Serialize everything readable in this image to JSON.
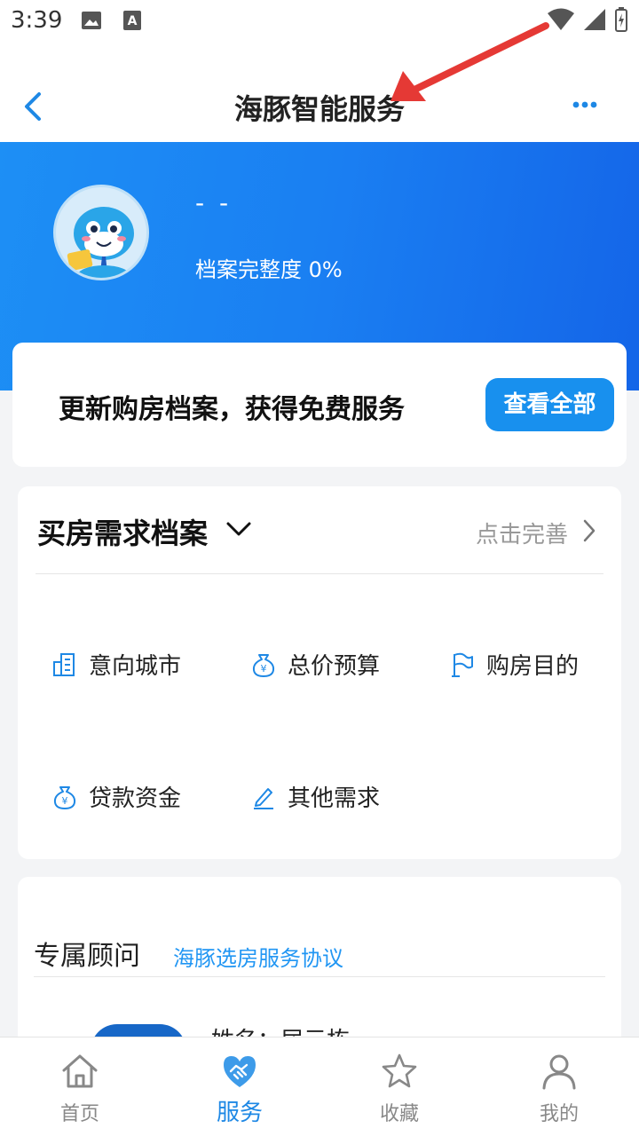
{
  "status_bar": {
    "time": "3:39"
  },
  "nav": {
    "title": "海豚智能服务"
  },
  "profile": {
    "name": "- -",
    "completeness": "档案完整度 0%"
  },
  "promo": {
    "text": "更新购房档案，获得免费服务",
    "button": "查看全部"
  },
  "demand": {
    "title": "买房需求档案",
    "action": "点击完善",
    "items": [
      {
        "label": "意向城市",
        "icon": "building-icon"
      },
      {
        "label": "总价预算",
        "icon": "money-bag-icon"
      },
      {
        "label": "购房目的",
        "icon": "flag-icon"
      },
      {
        "label": "贷款资金",
        "icon": "loan-bag-icon"
      },
      {
        "label": "其他需求",
        "icon": "edit-icon"
      }
    ]
  },
  "advisor": {
    "title": "专属顾问",
    "agreement_link": "海豚选房服务协议",
    "name": "姓名：屈元栋"
  },
  "tabs": [
    {
      "label": "首页",
      "icon": "home-icon"
    },
    {
      "label": "服务",
      "icon": "handshake-icon",
      "active": true
    },
    {
      "label": "收藏",
      "icon": "star-icon"
    },
    {
      "label": "我的",
      "icon": "person-icon"
    }
  ],
  "colors": {
    "accent": "#1890ee",
    "banner": "#1a7ff2",
    "annotation": "#e53935"
  }
}
